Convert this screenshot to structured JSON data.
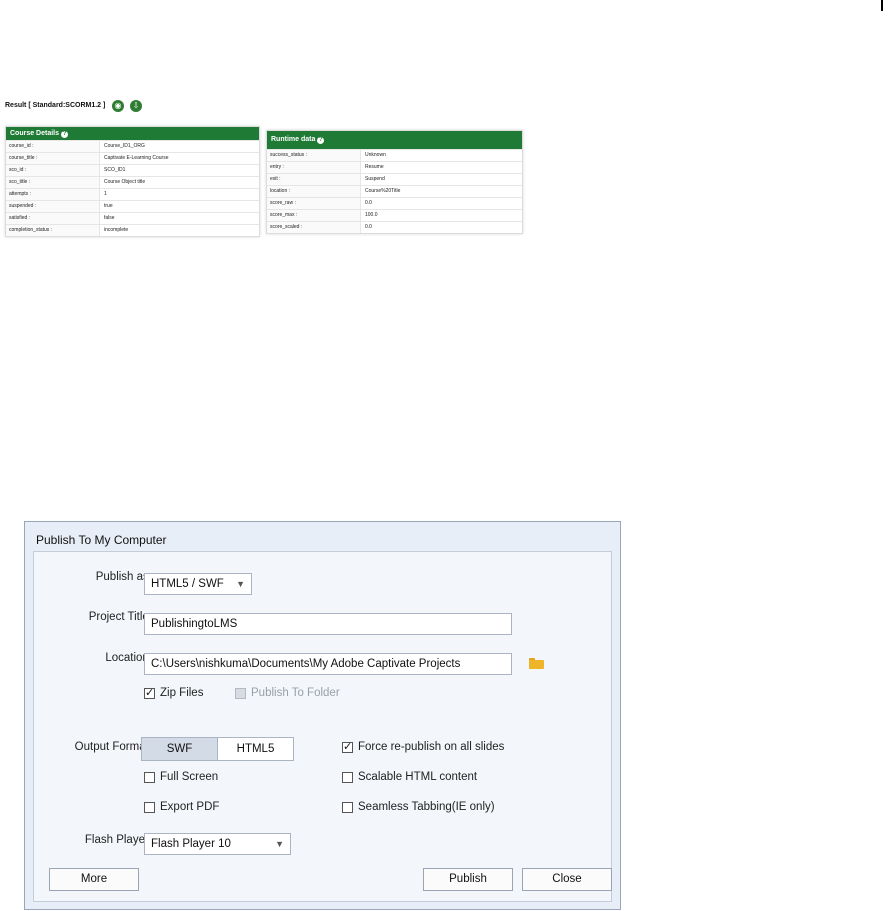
{
  "result": {
    "title": "Result [ Standard:SCORM1.2 ]",
    "icons": [
      "view-icon",
      "download-icon"
    ],
    "accent_color": "#1e7a34"
  },
  "course_details": {
    "heading": "Course Details",
    "rows": [
      {
        "key": "course_id :",
        "value": "Course_ID1_ORG"
      },
      {
        "key": "course_title :",
        "value": "Captivate E-Learning Course"
      },
      {
        "key": "sco_id :",
        "value": "SCO_ID1"
      },
      {
        "key": "sco_title :",
        "value": "Course Object title"
      },
      {
        "key": "attempts :",
        "value": "1"
      },
      {
        "key": "suspended :",
        "value": "true"
      },
      {
        "key": "satisfied :",
        "value": "false"
      },
      {
        "key": "completion_status :",
        "value": "incomplete"
      }
    ]
  },
  "runtime_data": {
    "heading": "Runtime data",
    "rows": [
      {
        "key": "success_status :",
        "value": "Unknown"
      },
      {
        "key": "entry :",
        "value": "Resume"
      },
      {
        "key": "exit :",
        "value": "Suspend"
      },
      {
        "key": "location :",
        "value": "Course%20Title"
      },
      {
        "key": "score_raw :",
        "value": "0.0"
      },
      {
        "key": "score_max :",
        "value": "100.0"
      },
      {
        "key": "score_scaled :",
        "value": "0.0"
      }
    ]
  },
  "dialog": {
    "title": "Publish To My Computer",
    "publish_as_label": "Publish as:",
    "publish_as_value": "HTML5 / SWF",
    "project_title_label": "Project Title:",
    "project_title_value": "PublishingtoLMS",
    "location_label": "Location:",
    "location_value": "C:\\Users\\nishkuma\\Documents\\My Adobe Captivate Projects",
    "zip_files": {
      "label": "Zip Files",
      "checked": true
    },
    "publish_to_folder": {
      "label": "Publish To Folder",
      "checked": false,
      "disabled": true
    },
    "output_format_label": "Output Format:",
    "output_formats": [
      "SWF",
      "HTML5"
    ],
    "output_format_selected": "SWF",
    "force_republish": {
      "label": "Force re-publish on all slides",
      "checked": true
    },
    "full_screen": {
      "label": "Full Screen",
      "checked": false
    },
    "scalable_html": {
      "label": "Scalable HTML content",
      "checked": false
    },
    "export_pdf": {
      "label": "Export PDF",
      "checked": false
    },
    "seamless_tabbing": {
      "label": "Seamless Tabbing(IE only)",
      "checked": false
    },
    "flash_player_label": "Flash Player:",
    "flash_player_value": "Flash Player 10",
    "buttons": {
      "more": "More",
      "publish": "Publish",
      "close": "Close"
    }
  }
}
